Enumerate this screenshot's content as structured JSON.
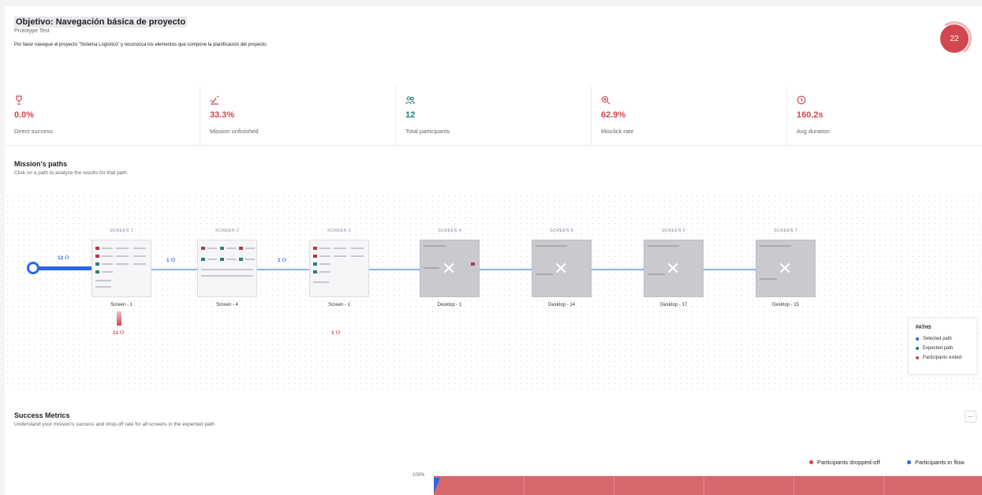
{
  "header": {
    "title": "Objetivo: Navegación básica de proyecto",
    "subtitle": "Prototype Test",
    "description": "Por favor navegue el proyecto \"Sistema Logístico\" y reconozca los elementos que compone la planificación del proyecto.",
    "score": "22"
  },
  "metrics": [
    {
      "icon": "trophy-icon",
      "value": "0.0%",
      "label": "Direct success"
    },
    {
      "icon": "unfinished-icon",
      "value": "33.3%",
      "label": "Mission unfinished"
    },
    {
      "icon": "participants-icon",
      "value": "12",
      "label": "Total participants"
    },
    {
      "icon": "misclick-icon",
      "value": "62.9%",
      "label": "Misclick rate"
    },
    {
      "icon": "clock-icon",
      "value": "160.2s",
      "label": "Avg duration"
    }
  ],
  "paths_section": {
    "title": "Mission's paths",
    "subtitle": "Click on a path to analyze the results for that path."
  },
  "screens": [
    {
      "header": "SCREEN 1",
      "label": "Screen - 1"
    },
    {
      "header": "SCREEN 2",
      "label": "Screen - 4"
    },
    {
      "header": "SCREEN 3",
      "label": "Screen - 1"
    },
    {
      "header": "SCREEN 4",
      "label": "Desktop - 1"
    },
    {
      "header": "SCREEN 5",
      "label": "Desktop - 14"
    },
    {
      "header": "SCREEN 6",
      "label": "Desktop - 17"
    },
    {
      "header": "SCREEN 7",
      "label": "Desktop - 15"
    }
  ],
  "path_counts": {
    "start": "12",
    "link1": "1",
    "link2": "1",
    "exit1": "11",
    "exit3": "1"
  },
  "legend": {
    "title": "PATHS",
    "items": [
      {
        "label": "Selected path",
        "color": "#2f66e6"
      },
      {
        "label": "Expected path",
        "color": "#1d7f7a"
      },
      {
        "label": "Participants exited",
        "color": "#d1464f"
      }
    ]
  },
  "success_metrics": {
    "title": "Success Metrics",
    "subtitle": "Understand your mission's success and drop-off rate for all screens in the expected path",
    "more_label": "...",
    "legend_dropped": "Participants dropped-off",
    "legend_flow": "Participants in flow",
    "axis_top": "100%"
  },
  "colors": {
    "accent_red": "#d1464f",
    "accent_blue": "#2f66e6",
    "accent_teal": "#1d7f7a"
  }
}
